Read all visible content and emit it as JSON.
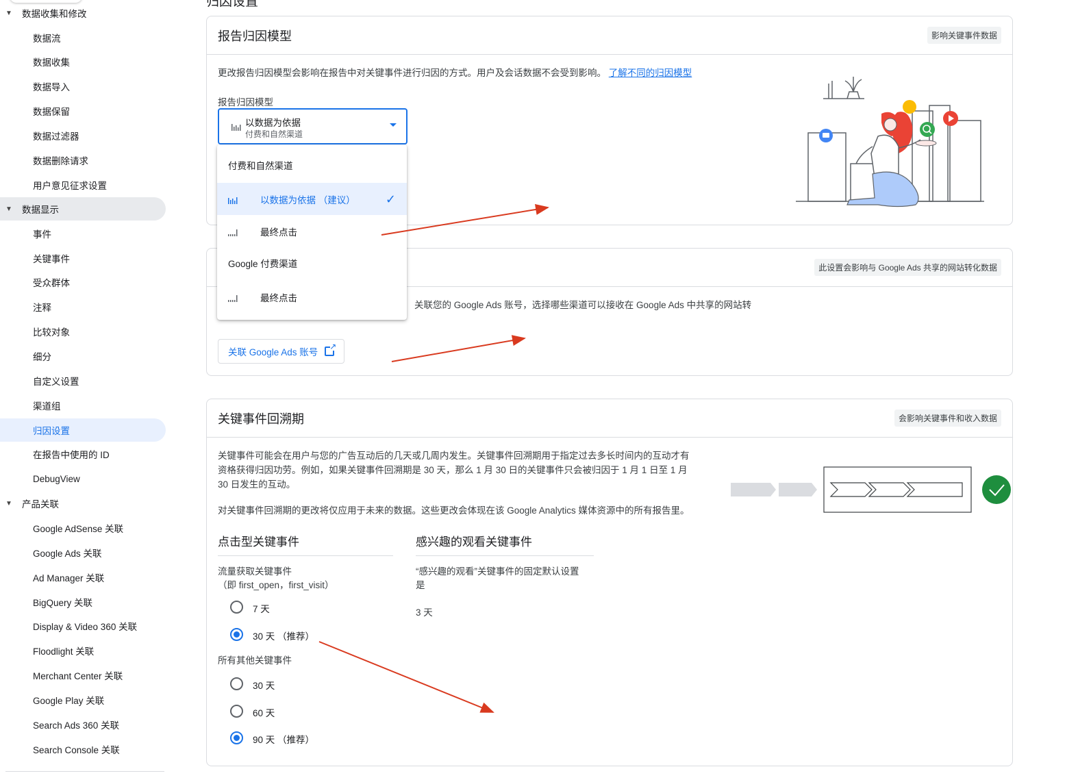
{
  "page": {
    "title": "归因设置"
  },
  "sidebar": {
    "sections": [
      {
        "label": "数据收集和修改",
        "children": [
          "数据流",
          "数据收集",
          "数据导入",
          "数据保留",
          "数据过滤器",
          "数据删除请求",
          "用户意见征求设置"
        ]
      },
      {
        "label": "数据显示",
        "children": [
          "事件",
          "关键事件",
          "受众群体",
          "注释",
          "比较对象",
          "细分",
          "自定义设置",
          "渠道组",
          "归因设置",
          "在报告中使用的 ID",
          "DebugView"
        ]
      },
      {
        "label": "产品关联",
        "children": [
          "Google AdSense 关联",
          "Google Ads 关联",
          "Ad Manager 关联",
          "BigQuery 关联",
          "Display & Video 360 关联",
          "Floodlight 关联",
          "Merchant Center 关联",
          "Google Play 关联",
          "Search Ads 360 关联",
          "Search Console 关联"
        ]
      }
    ],
    "active_item": "归因设置"
  },
  "report_model": {
    "title": "报告归因模型",
    "tag": "影响关键事件数据",
    "description": "更改报告归因模型会影响在报告中对关键事件进行归因的方式。用户及会话数据不会受到影响。",
    "link": "了解不同的归因模型",
    "field_label": "报告归因模型",
    "selected_value": "以数据为依据",
    "selected_sub": "付费和自然渠道",
    "menu": {
      "group1": "付费和自然渠道",
      "item1": "以数据为依据 （建议）",
      "item2": "最终点击",
      "group2": "Google 付费渠道",
      "item3": "最终点击"
    }
  },
  "ads_channels": {
    "tag": "此设置会影响与 Google Ads 共享的网站转化数据",
    "description": "关联您的 Google Ads 账号，选择哪些渠道可以接收在 Google Ads 中共享的网站转",
    "button": "关联 Google Ads 账号"
  },
  "lookback": {
    "title": "关键事件回溯期",
    "tag": "会影响关键事件和收入数据",
    "desc_line1": "关键事件可能会在用户与您的广告互动后的几天或几周内发生。关键事件回溯期用于指定过去多长时间内的互动才有",
    "desc_line2": "资格获得归因功劳。例如，如果关键事件回溯期是 30 天，那么 1 月 30 日的关键事件只会被归因于 1 月 1 日至 1 月",
    "desc_line3": "30 日发生的互动。",
    "desc_future": "对关键事件回溯期的更改将仅应用于未来的数据。这些更改会体现在该 Google Analytics 媒体资源中的所有报告里。",
    "click": {
      "title": "点击型关键事件",
      "acq_label": "流量获取关键事件",
      "acq_sub": "（即 first_open，first_visit）",
      "acq_options": [
        "7 天",
        "30 天 （推荐）"
      ],
      "acq_selected": 1,
      "other_label": "所有其他关键事件",
      "other_options": [
        "30 天",
        "60 天",
        "90 天 （推荐）"
      ],
      "other_selected": 2
    },
    "view": {
      "title": "感兴趣的观看关键事件",
      "desc_line1": "“感兴趣的观看”关键事件的固定默认设置",
      "desc_line2": "是",
      "value": "3 天"
    }
  },
  "colors": {
    "accent": "#1a73e8",
    "annotation_arrow": "#d93a1f",
    "success": "#1e8e3e"
  }
}
